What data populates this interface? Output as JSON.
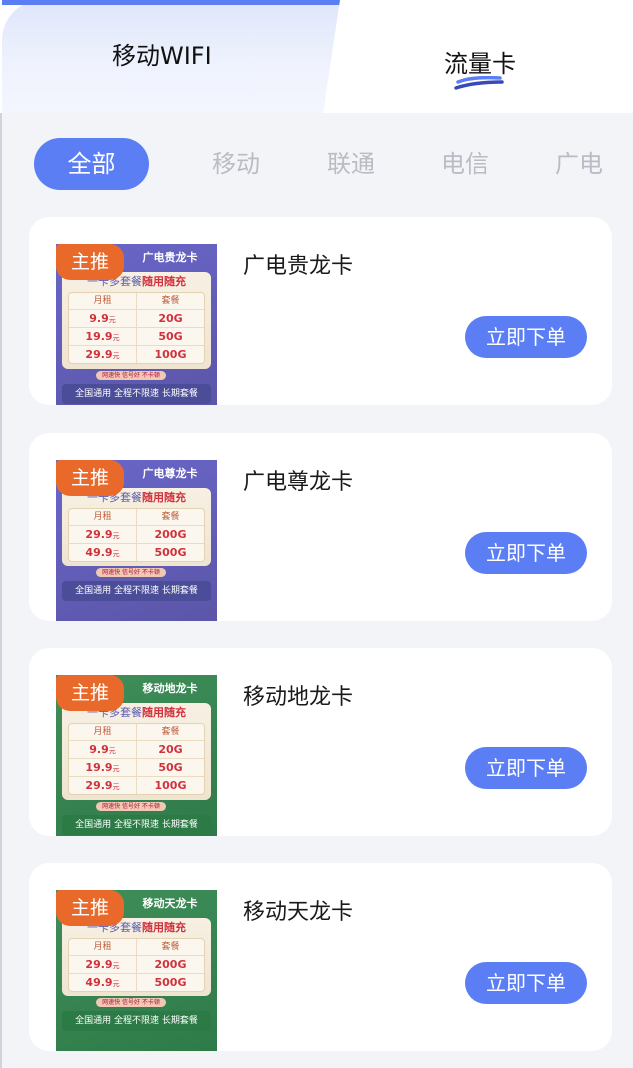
{
  "tabs": {
    "wifi_label": "移动WIFI",
    "card_label": "流量卡"
  },
  "filters": [
    "全部",
    "移动",
    "联通",
    "电信",
    "广电"
  ],
  "accent": "#5b7ef5",
  "badge_color": "#e9692a",
  "products": [
    {
      "name": "广电贵龙卡",
      "badge": "主推",
      "button": "立即下单",
      "thumb": {
        "theme": "purple",
        "title": "广电贵龙卡",
        "slogan_a": "一卡多套餐",
        "slogan_b": "随用随充",
        "col_rent": "月租",
        "col_plan": "套餐",
        "rows": [
          {
            "price": "9.9",
            "unit": "元",
            "data": "20G"
          },
          {
            "price": "19.9",
            "unit": "元",
            "data": "50G"
          },
          {
            "price": "29.9",
            "unit": "元",
            "data": "100G"
          }
        ],
        "note": "网速快 信号好 不卡顿",
        "footer": "全国通用 全程不限速 长期套餐"
      }
    },
    {
      "name": "广电尊龙卡",
      "badge": "主推",
      "button": "立即下单",
      "thumb": {
        "theme": "purple",
        "title": "广电尊龙卡",
        "slogan_a": "一卡多套餐",
        "slogan_b": "随用随充",
        "col_rent": "月租",
        "col_plan": "套餐",
        "rows": [
          {
            "price": "29.9",
            "unit": "元",
            "data": "200G"
          },
          {
            "price": "49.9",
            "unit": "元",
            "data": "500G"
          }
        ],
        "note": "网速快 信号好 不卡顿",
        "footer": "全国通用 全程不限速 长期套餐"
      }
    },
    {
      "name": "移动地龙卡",
      "badge": "主推",
      "button": "立即下单",
      "thumb": {
        "theme": "green",
        "title": "移动地龙卡",
        "slogan_a": "一卡多套餐",
        "slogan_b": "随用随充",
        "col_rent": "月租",
        "col_plan": "套餐",
        "rows": [
          {
            "price": "9.9",
            "unit": "元",
            "data": "20G"
          },
          {
            "price": "19.9",
            "unit": "元",
            "data": "50G"
          },
          {
            "price": "29.9",
            "unit": "元",
            "data": "100G"
          }
        ],
        "note": "网速快 信号好 不卡顿",
        "footer": "全国通用 全程不限速 长期套餐"
      }
    },
    {
      "name": "移动天龙卡",
      "badge": "主推",
      "button": "立即下单",
      "thumb": {
        "theme": "green",
        "title": "移动天龙卡",
        "slogan_a": "一卡多套餐",
        "slogan_b": "随用随充",
        "col_rent": "月租",
        "col_plan": "套餐",
        "rows": [
          {
            "price": "29.9",
            "unit": "元",
            "data": "200G"
          },
          {
            "price": "49.9",
            "unit": "元",
            "data": "500G"
          }
        ],
        "note": "网速快 信号好 不卡顿",
        "footer": "全国通用 全程不限速 长期套餐"
      }
    }
  ]
}
